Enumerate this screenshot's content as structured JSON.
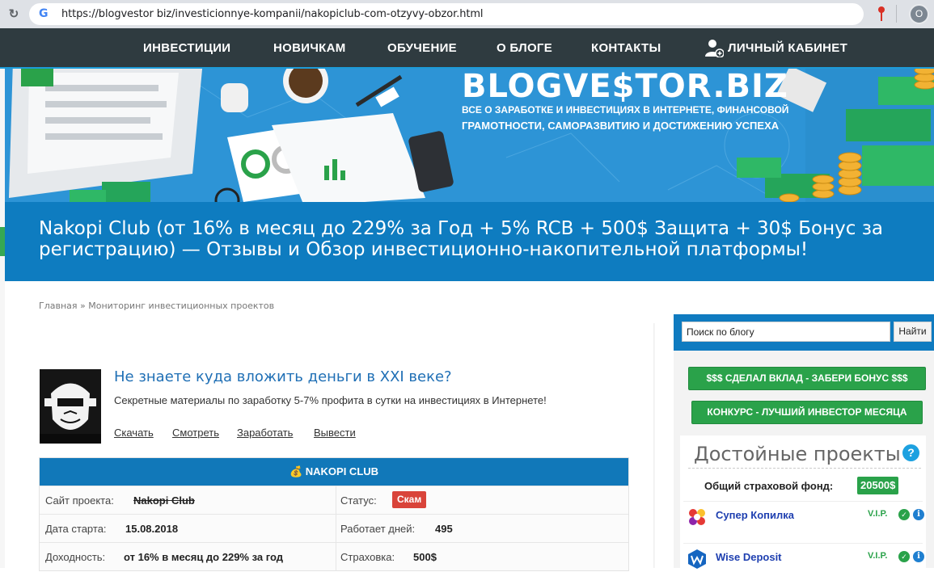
{
  "browser": {
    "url": "https://blogvestor biz/investicionnye-kompanii/nakopiclub-com-otzyvy-obzor.html",
    "profile_initial": "O"
  },
  "nav": {
    "items": [
      "ИНВЕСТИЦИИ",
      "НОВИЧКАМ",
      "ОБУЧЕНИЕ",
      "О БЛОГЕ",
      "КОНТАКТЫ",
      "ЛИЧНЫЙ КАБИНЕТ"
    ]
  },
  "banner": {
    "brand": "BLOGVE$TOR.BIZ",
    "tagline_line1": "ВСЕ О ЗАРАБОТКЕ И ИНВЕСТИЦИЯХ В ИНТЕРНЕТЕ, ФИНАНСОВОЙ",
    "tagline_line2": "ГРАМОТНОСТИ, САМОРАЗВИТИЮ И ДОСТИЖЕНИЮ УСПЕХА"
  },
  "article": {
    "title": "Nakopi Club (от 16% в месяц до 229% за Год + 5% RCB + 500$ Защита + 30$ Бонус за регистрацию) — Отзывы и Обзор инвестиционно-накопительной платформы!"
  },
  "breadcrumb": {
    "home": "Главная",
    "separator": "»",
    "section": "Мониторинг инвестиционных проектов"
  },
  "promo": {
    "heading": "Не знаете куда вложить деньги в XXI веке?",
    "text": "Секретные материалы по заработку 5-7% профита в сутки на инвестициях в Интернете!",
    "links": [
      "Скачать",
      "Смотреть",
      "Заработать",
      "Вывести"
    ]
  },
  "project": {
    "name": "NAKOPI CLUB",
    "rows": [
      {
        "l_label": "Сайт проекта:",
        "l_value": "Nakopi Club",
        "r_label": "Статус:",
        "r_value": "Скам"
      },
      {
        "l_label": "Дата старта:",
        "l_value": "15.08.2018",
        "r_label": "Работает дней:",
        "r_value": "495"
      },
      {
        "l_label": "Доходность:",
        "l_value": "от 16% в месяц до 229% за год",
        "r_label": "Страховка:",
        "r_value": "500$"
      }
    ]
  },
  "sidebar": {
    "search_value": "Поиск по блогу",
    "search_button": "Найти",
    "bonus_button": "$$$ СДЕЛАЛ ВКЛАД - ЗАБЕРИ БОНУС $$$",
    "contest_button": "КОНКУРС - ЛУЧШИЙ ИНВЕСТОР МЕСЯЦА",
    "projects_title": "Достойные проекты",
    "fund_label": "Общий страховой фонд:",
    "fund_value": "20500$",
    "projects": [
      {
        "name": "Супер Копилка",
        "badge": "V.I.P."
      },
      {
        "name": "Wise Deposit",
        "badge": "V.I.P."
      }
    ]
  },
  "colors": {
    "nav_bg": "#2f3b40",
    "banner_bg": "#2d94d6",
    "title_band": "#0e7cc0",
    "accent_green": "#2aa24a",
    "scam_red": "#d9443a"
  }
}
